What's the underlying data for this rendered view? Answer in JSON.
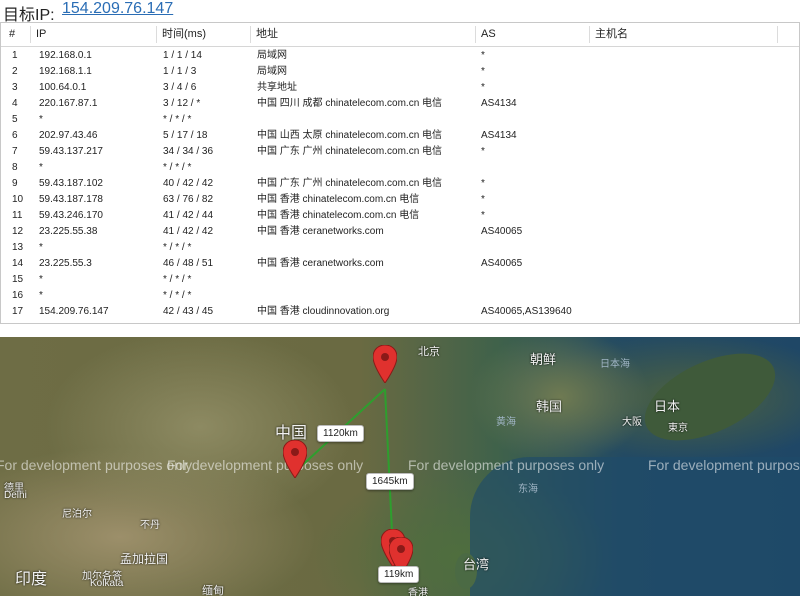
{
  "header": {
    "label": "目标IP:",
    "ip": "154.209.76.147"
  },
  "table": {
    "columns": [
      "#",
      "IP",
      "时间(ms)",
      "地址",
      "AS",
      "主机名"
    ],
    "rows": [
      {
        "idx": "1",
        "ip": "192.168.0.1",
        "time": "1 / 1 / 14",
        "addr": "局域网",
        "as": "*"
      },
      {
        "idx": "2",
        "ip": "192.168.1.1",
        "time": "1 / 1 / 3",
        "addr": "局域网",
        "as": "*"
      },
      {
        "idx": "3",
        "ip": "100.64.0.1",
        "time": "3 / 4 / 6",
        "addr": "共享地址",
        "as": "*"
      },
      {
        "idx": "4",
        "ip": "220.167.87.1",
        "time": "3 / 12 / *",
        "addr": "中国 四川 成都 chinatelecom.com.cn 电信",
        "as": "AS4134"
      },
      {
        "idx": "5",
        "ip": "*",
        "time": "* / * / *",
        "addr": "",
        "as": ""
      },
      {
        "idx": "6",
        "ip": "202.97.43.46",
        "time": "5 / 17 / 18",
        "addr": "中国 山西 太原 chinatelecom.com.cn 电信",
        "as": "AS4134"
      },
      {
        "idx": "7",
        "ip": "59.43.137.217",
        "time": "34 / 34 / 36",
        "addr": "中国 广东 广州 chinatelecom.com.cn 电信",
        "as": "*"
      },
      {
        "idx": "8",
        "ip": "*",
        "time": "* / * / *",
        "addr": "",
        "as": ""
      },
      {
        "idx": "9",
        "ip": "59.43.187.102",
        "time": "40 / 42 / 42",
        "addr": "中国 广东 广州 chinatelecom.com.cn 电信",
        "as": "*"
      },
      {
        "idx": "10",
        "ip": "59.43.187.178",
        "time": "63 / 76 / 82",
        "addr": "中国 香港 chinatelecom.com.cn 电信",
        "as": "*"
      },
      {
        "idx": "11",
        "ip": "59.43.246.170",
        "time": "41 / 42 / 44",
        "addr": "中国 香港 chinatelecom.com.cn 电信",
        "as": "*"
      },
      {
        "idx": "12",
        "ip": "23.225.55.38",
        "time": "41 / 42 / 42",
        "addr": "中国 香港 ceranetworks.com",
        "as": "AS40065"
      },
      {
        "idx": "13",
        "ip": "*",
        "time": "* / * / *",
        "addr": "",
        "as": ""
      },
      {
        "idx": "14",
        "ip": "23.225.55.3",
        "time": "46 / 48 / 51",
        "addr": "中国 香港 ceranetworks.com",
        "as": "AS40065"
      },
      {
        "idx": "15",
        "ip": "*",
        "time": "* / * / *",
        "addr": "",
        "as": ""
      },
      {
        "idx": "16",
        "ip": "*",
        "time": "* / * / *",
        "addr": "",
        "as": ""
      },
      {
        "idx": "17",
        "ip": "154.209.76.147",
        "time": "42 / 43 / 45",
        "addr": "中国 香港 cloudinnovation.org",
        "as": "AS40065,AS139640"
      }
    ]
  },
  "map": {
    "watermark": "For development purposes only",
    "labels": {
      "beijing": "北京",
      "korea_north": "朝鲜",
      "japan_sea": "日本海",
      "korea_south": "韩国",
      "japan": "日本",
      "osaka": "大阪",
      "tokyo": "東京",
      "china": "中国",
      "yellow_sea": "黄海",
      "east_sea": "东海",
      "delhi_cn": "德里",
      "delhi": "Delhi",
      "nepal": "尼泊尔",
      "bhutan": "不丹",
      "bangladesh": "孟加拉国",
      "kolkata_cn": "加尔各答",
      "kolkata": "Kolkata",
      "india": "印度",
      "myanmar": "缅甸",
      "taiwan": "台湾",
      "hongkong": "香港"
    },
    "distances": {
      "d1": "1120km",
      "d2": "1645km",
      "d3": "119km"
    },
    "route_color": "#2e9e2e",
    "pin_color": "#e0312e"
  }
}
